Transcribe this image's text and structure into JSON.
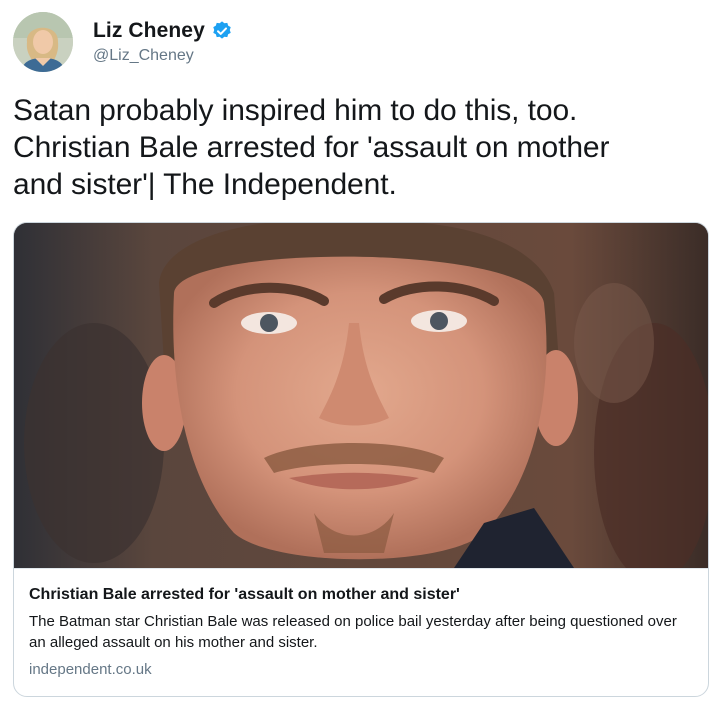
{
  "author": {
    "display_name": "Liz Cheney",
    "handle": "@Liz_Cheney",
    "verified": true
  },
  "tweet": {
    "text": "Satan probably inspired him to do this, too.\nChristian Bale arrested for 'assault on mother\nand sister'| The Independent."
  },
  "card": {
    "title": "Christian Bale arrested for 'assault on mother and sister'",
    "description": "The Batman star Christian Bale was released on police bail yesterday after being questioned over an alleged assault on his mother and sister.",
    "domain": "independent.co.uk"
  },
  "colors": {
    "verified_blue": "#1da1f2",
    "secondary_text": "#657786",
    "card_border": "#ccd6dd"
  }
}
